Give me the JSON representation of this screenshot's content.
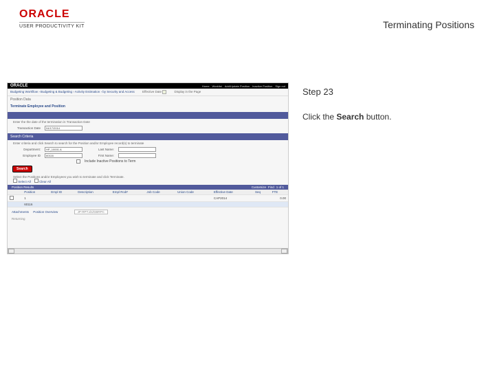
{
  "header": {
    "logo_word": "ORACLE",
    "logo_sub": "USER PRODUCTIVITY KIT",
    "page_title": "Terminating Positions"
  },
  "side": {
    "step": "Step 23",
    "desc_pre": "Click the ",
    "desc_bold": "Search",
    "desc_post": " button."
  },
  "frame": {
    "brand": "ORACLE",
    "menus": [
      "Home",
      "Worklist",
      "Add/Update Position",
      "Inactive Position",
      "Sign out"
    ],
    "crumb": "Budgeting Workflow  ›  Budgeting & Budgeting  ›  Activity Estimation  ›  by Security and Access",
    "eff_label": "Effective Date",
    "disp_label": "Display in the Page",
    "sect_position": "Position Data",
    "hd": "Terminate Employee and Position",
    "date_desc": "Enter the the date of the termination in Transaction Date",
    "trans_label": "Transaction Date",
    "trans_value": "04/17/2014",
    "sect_search": "Search Criteria",
    "instr": "Enter criteria and click Search to search for the Position and/or Employee record(s) to terminate",
    "dep_label": "Department:",
    "dep_value": "HP_10001.A",
    "ln_label": "Last Name:",
    "emp_label": "Employee ID",
    "emp_value": "60116",
    "fn_label": "First Name:",
    "chk_label": "Include Inactive Positions to Term",
    "search_btn": "Search",
    "select_desc": "Select the Positions and/or Employees you wish to terminate and click Terminate.",
    "select_all": "Select All",
    "clear_all": "Clear All",
    "sect_results": "Position Results",
    "res_rhs": [
      "Customize",
      "Find",
      "1 of 1"
    ],
    "cols": [
      "",
      "Position",
      "Empl ID",
      "Description",
      "Empl Rcd#",
      "Job Code",
      "Union Code",
      "Effective Date",
      "Seq",
      "FTE"
    ],
    "rows": [
      {
        "a": "",
        "b": "1",
        "c": "",
        "d": "",
        "e": "",
        "f": "",
        "g": "",
        "h": "CAP2014",
        "i": "",
        "j": "0.00"
      },
      {
        "a": "",
        "b": "60116",
        "c": "",
        "d": "",
        "e": "",
        "f": "",
        "g": "",
        "h": "",
        "i": "",
        "j": ""
      }
    ],
    "footer": {
      "attach": "Attachments",
      "overview": "Position Overview",
      "overview_lbl": "",
      "overview_val": "JP-RPT.xls/GBRPC"
    },
    "returning": "Returning"
  }
}
